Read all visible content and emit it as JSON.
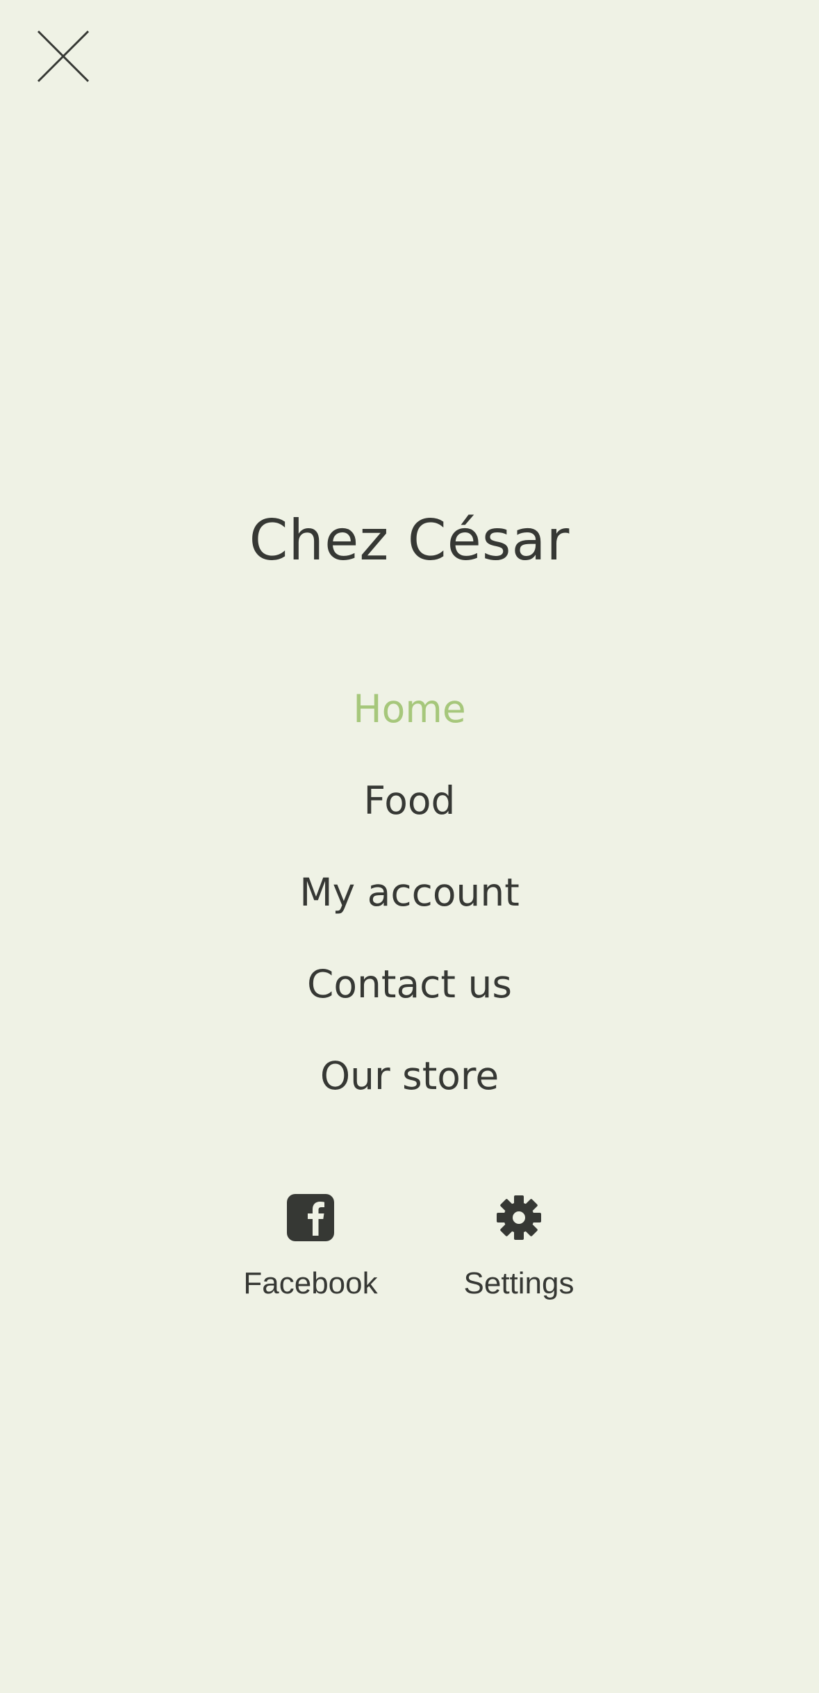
{
  "header": {
    "close_icon": "close-icon"
  },
  "brand": {
    "title": "Chez César"
  },
  "nav": {
    "items": [
      {
        "label": "Home",
        "active": true
      },
      {
        "label": "Food",
        "active": false
      },
      {
        "label": "My account",
        "active": false
      },
      {
        "label": "Contact us",
        "active": false
      },
      {
        "label": "Our store",
        "active": false
      }
    ]
  },
  "actions": {
    "facebook": {
      "label": "Facebook",
      "icon": "facebook-icon"
    },
    "settings": {
      "label": "Settings",
      "icon": "gear-icon"
    }
  },
  "colors": {
    "background": "#eff2e5",
    "text": "#363834",
    "accent": "#a6c77b"
  }
}
